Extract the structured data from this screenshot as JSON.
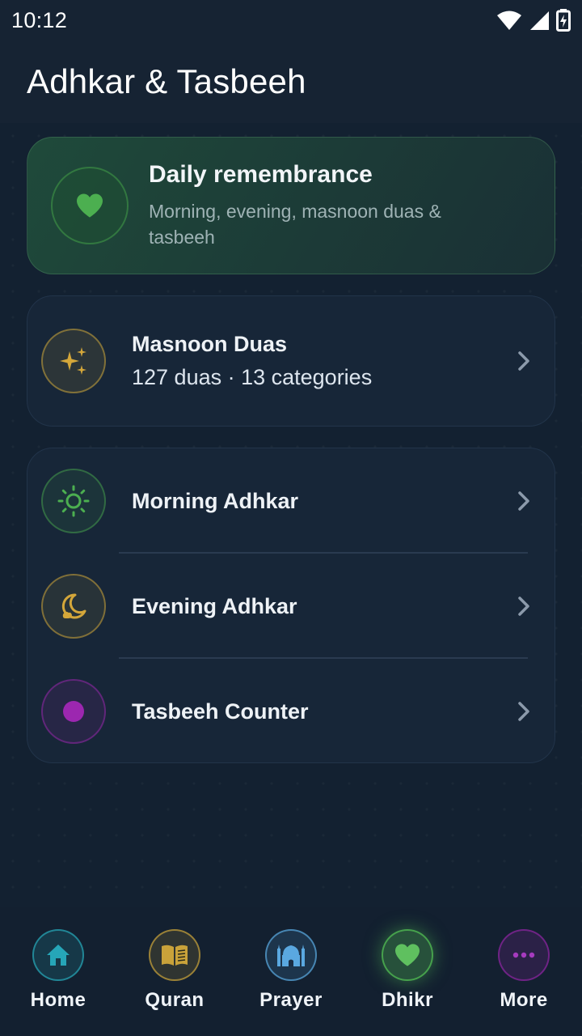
{
  "status_bar": {
    "time": "10:12"
  },
  "app_bar": {
    "title": "Adhkar & Tasbeeh"
  },
  "hero": {
    "title": "Daily remembrance",
    "subtitle": "Morning, evening, masnoon duas & tasbeeh",
    "icon": "heart-icon"
  },
  "duas_card": {
    "title": "Masnoon Duas",
    "subtitle": "127 duas · 13 categories",
    "icon": "sparkles-icon"
  },
  "adhkar_list": [
    {
      "title": "Morning Adhkar",
      "icon": "sun-icon",
      "color": "#4caf50"
    },
    {
      "title": "Evening Adhkar",
      "icon": "moon-icon",
      "color": "#d4a73a"
    },
    {
      "title": "Tasbeeh Counter",
      "icon": "dot-icon",
      "color": "#9c27b0"
    }
  ],
  "bottom_nav": {
    "items": [
      {
        "label": "Home",
        "icon": "home-icon",
        "color": "#26a6b8"
      },
      {
        "label": "Quran",
        "icon": "book-icon",
        "color": "#c9a23a"
      },
      {
        "label": "Prayer",
        "icon": "mosque-icon",
        "color": "#5aa8e0"
      },
      {
        "label": "Dhikr",
        "icon": "heart-icon",
        "color": "#4caf50",
        "active": true
      },
      {
        "label": "More",
        "icon": "more-dots-icon",
        "color": "#9c27b0"
      }
    ]
  },
  "colors": {
    "background": "#132131",
    "card": "#172638",
    "accent_green": "#4caf50",
    "accent_gold": "#d4a73a",
    "accent_purple": "#9c27b0"
  }
}
